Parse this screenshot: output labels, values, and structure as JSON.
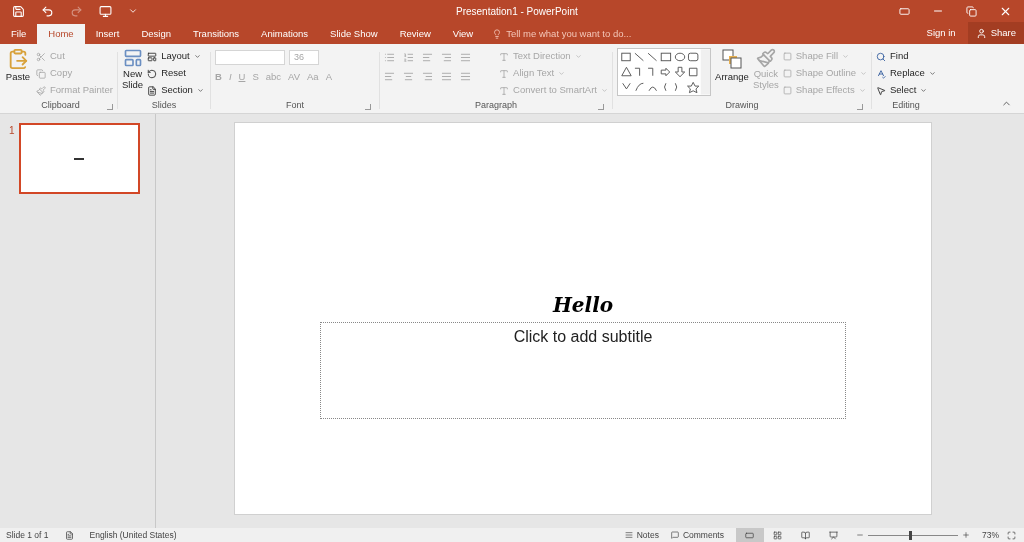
{
  "title_bar": {
    "title": "Presentation1 - PowerPoint"
  },
  "tabs": [
    {
      "label": "File",
      "selected": false
    },
    {
      "label": "Home",
      "selected": true
    },
    {
      "label": "Insert",
      "selected": false
    },
    {
      "label": "Design",
      "selected": false
    },
    {
      "label": "Transitions",
      "selected": false
    },
    {
      "label": "Animations",
      "selected": false
    },
    {
      "label": "Slide Show",
      "selected": false
    },
    {
      "label": "Review",
      "selected": false
    },
    {
      "label": "View",
      "selected": false
    }
  ],
  "tell_me": {
    "placeholder": "Tell me what you want to do..."
  },
  "account": {
    "sign_in": "Sign in",
    "share": "Share"
  },
  "clipboard": {
    "name": "Clipboard",
    "paste": "Paste",
    "items": [
      {
        "label": "Cut",
        "disabled": true
      },
      {
        "label": "Copy",
        "disabled": true
      },
      {
        "label": "Format Painter",
        "disabled": true
      }
    ]
  },
  "slides_group": {
    "name": "Slides",
    "new_slide": [
      "New",
      "Slide"
    ],
    "items": [
      {
        "label": "Layout",
        "disabled": false
      },
      {
        "label": "Reset",
        "disabled": false
      },
      {
        "label": "Section",
        "disabled": false
      }
    ]
  },
  "font": {
    "name": "Font",
    "size": "36",
    "disabled": true,
    "buttons": [
      "B",
      "I",
      "U",
      "S",
      "abc",
      "AV",
      "Aa",
      "A"
    ]
  },
  "paragraph": {
    "name": "Paragraph",
    "items": [
      {
        "label": "Text Direction",
        "disabled": true
      },
      {
        "label": "Align Text",
        "disabled": true
      },
      {
        "label": "Convert to SmartArt",
        "disabled": true
      }
    ]
  },
  "drawing": {
    "name": "Drawing",
    "arrange": "Arrange",
    "quick_styles": [
      "Quick",
      "Styles"
    ],
    "quick_styles_disabled": true,
    "items": [
      {
        "label": "Shape Fill",
        "disabled": true
      },
      {
        "label": "Shape Outline",
        "disabled": true
      },
      {
        "label": "Shape Effects",
        "disabled": true
      }
    ]
  },
  "editing": {
    "name": "Editing",
    "items": [
      {
        "label": "Find",
        "disabled": false
      },
      {
        "label": "Replace",
        "disabled": false
      },
      {
        "label": "Select",
        "disabled": false
      }
    ]
  },
  "thumbnails": [
    {
      "number": "1",
      "selected": true
    }
  ],
  "slide": {
    "title": "Hello",
    "subtitle_placeholder": "Click to add subtitle"
  },
  "status_bar": {
    "slide": "Slide 1 of 1",
    "language": "English (United States)",
    "notes": "Notes",
    "comments": "Comments",
    "views": [
      {
        "kind": "normal",
        "selected": true
      },
      {
        "kind": "sorter",
        "selected": false
      },
      {
        "kind": "reading",
        "selected": false
      },
      {
        "kind": "show",
        "selected": false
      }
    ],
    "zoom": {
      "level": 0.46,
      "reading": "73%"
    }
  }
}
